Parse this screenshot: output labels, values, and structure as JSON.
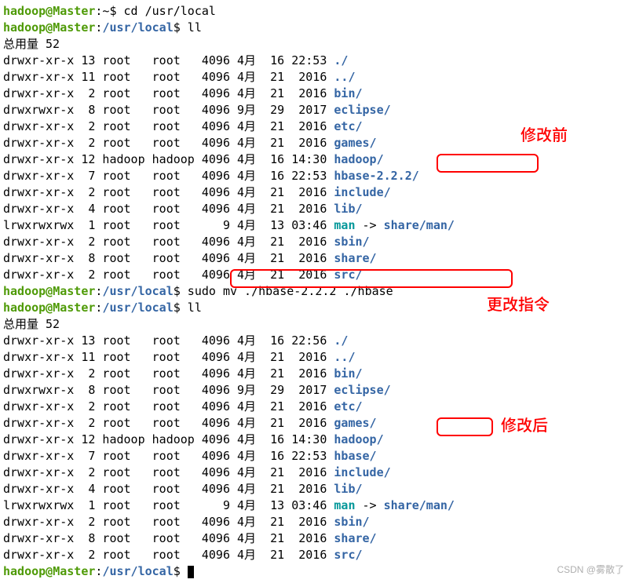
{
  "prompt1": {
    "user": "hadoop",
    "host": "Master",
    "path": "~",
    "cmd": "cd /usr/local"
  },
  "prompt2": {
    "user": "hadoop",
    "host": "Master",
    "path": "/usr/local",
    "cmd": "ll"
  },
  "total1": "总用量 52",
  "ls1": [
    {
      "perm": "drwxr-xr-x",
      "links": "13",
      "owner": "root  ",
      "group": "root  ",
      "size": "4096",
      "month": "4月 ",
      "day": "16",
      "time": "22:53",
      "name": "./",
      "type": "dir"
    },
    {
      "perm": "drwxr-xr-x",
      "links": "11",
      "owner": "root  ",
      "group": "root  ",
      "size": "4096",
      "month": "4月 ",
      "day": "21",
      "time": " 2016",
      "name": "../",
      "type": "dir"
    },
    {
      "perm": "drwxr-xr-x",
      "links": " 2",
      "owner": "root  ",
      "group": "root  ",
      "size": "4096",
      "month": "4月 ",
      "day": "21",
      "time": " 2016",
      "name": "bin/",
      "type": "dir"
    },
    {
      "perm": "drwxrwxr-x",
      "links": " 8",
      "owner": "root  ",
      "group": "root  ",
      "size": "4096",
      "month": "9月 ",
      "day": "29",
      "time": " 2017",
      "name": "eclipse/",
      "type": "dir"
    },
    {
      "perm": "drwxr-xr-x",
      "links": " 2",
      "owner": "root  ",
      "group": "root  ",
      "size": "4096",
      "month": "4月 ",
      "day": "21",
      "time": " 2016",
      "name": "etc/",
      "type": "dir"
    },
    {
      "perm": "drwxr-xr-x",
      "links": " 2",
      "owner": "root  ",
      "group": "root  ",
      "size": "4096",
      "month": "4月 ",
      "day": "21",
      "time": " 2016",
      "name": "games/",
      "type": "dir"
    },
    {
      "perm": "drwxr-xr-x",
      "links": "12",
      "owner": "hadoop",
      "group": "hadoop",
      "size": "4096",
      "month": "4月 ",
      "day": "16",
      "time": "14:30",
      "name": "hadoop/",
      "type": "dir"
    },
    {
      "perm": "drwxr-xr-x",
      "links": " 7",
      "owner": "root  ",
      "group": "root  ",
      "size": "4096",
      "month": "4月 ",
      "day": "16",
      "time": "22:53",
      "name": "hbase-2.2.2/",
      "type": "dir"
    },
    {
      "perm": "drwxr-xr-x",
      "links": " 2",
      "owner": "root  ",
      "group": "root  ",
      "size": "4096",
      "month": "4月 ",
      "day": "21",
      "time": " 2016",
      "name": "include/",
      "type": "dir"
    },
    {
      "perm": "drwxr-xr-x",
      "links": " 4",
      "owner": "root  ",
      "group": "root  ",
      "size": "4096",
      "month": "4月 ",
      "day": "21",
      "time": " 2016",
      "name": "lib/",
      "type": "dir"
    },
    {
      "perm": "lrwxrwxrwx",
      "links": " 1",
      "owner": "root  ",
      "group": "root  ",
      "size": "   9",
      "month": "4月 ",
      "day": "13",
      "time": "03:46",
      "name": "man",
      "type": "sym",
      "target": "share/man/"
    },
    {
      "perm": "drwxr-xr-x",
      "links": " 2",
      "owner": "root  ",
      "group": "root  ",
      "size": "4096",
      "month": "4月 ",
      "day": "21",
      "time": " 2016",
      "name": "sbin/",
      "type": "dir"
    },
    {
      "perm": "drwxr-xr-x",
      "links": " 8",
      "owner": "root  ",
      "group": "root  ",
      "size": "4096",
      "month": "4月 ",
      "day": "21",
      "time": " 2016",
      "name": "share/",
      "type": "dir"
    },
    {
      "perm": "drwxr-xr-x",
      "links": " 2",
      "owner": "root  ",
      "group": "root  ",
      "size": "4096",
      "month": "4月 ",
      "day": "21",
      "time": " 2016",
      "name": "src/",
      "type": "dir"
    }
  ],
  "prompt3": {
    "user": "hadoop",
    "host": "Master",
    "path": "/usr/local",
    "cmd": "sudo mv ./hbase-2.2.2 ./hbase"
  },
  "prompt4": {
    "user": "hadoop",
    "host": "Master",
    "path": "/usr/local",
    "cmd": "ll"
  },
  "total2": "总用量 52",
  "ls2": [
    {
      "perm": "drwxr-xr-x",
      "links": "13",
      "owner": "root  ",
      "group": "root  ",
      "size": "4096",
      "month": "4月 ",
      "day": "16",
      "time": "22:56",
      "name": "./",
      "type": "dir"
    },
    {
      "perm": "drwxr-xr-x",
      "links": "11",
      "owner": "root  ",
      "group": "root  ",
      "size": "4096",
      "month": "4月 ",
      "day": "21",
      "time": " 2016",
      "name": "../",
      "type": "dir"
    },
    {
      "perm": "drwxr-xr-x",
      "links": " 2",
      "owner": "root  ",
      "group": "root  ",
      "size": "4096",
      "month": "4月 ",
      "day": "21",
      "time": " 2016",
      "name": "bin/",
      "type": "dir"
    },
    {
      "perm": "drwxrwxr-x",
      "links": " 8",
      "owner": "root  ",
      "group": "root  ",
      "size": "4096",
      "month": "9月 ",
      "day": "29",
      "time": " 2017",
      "name": "eclipse/",
      "type": "dir"
    },
    {
      "perm": "drwxr-xr-x",
      "links": " 2",
      "owner": "root  ",
      "group": "root  ",
      "size": "4096",
      "month": "4月 ",
      "day": "21",
      "time": " 2016",
      "name": "etc/",
      "type": "dir"
    },
    {
      "perm": "drwxr-xr-x",
      "links": " 2",
      "owner": "root  ",
      "group": "root  ",
      "size": "4096",
      "month": "4月 ",
      "day": "21",
      "time": " 2016",
      "name": "games/",
      "type": "dir"
    },
    {
      "perm": "drwxr-xr-x",
      "links": "12",
      "owner": "hadoop",
      "group": "hadoop",
      "size": "4096",
      "month": "4月 ",
      "day": "16",
      "time": "14:30",
      "name": "hadoop/",
      "type": "dir"
    },
    {
      "perm": "drwxr-xr-x",
      "links": " 7",
      "owner": "root  ",
      "group": "root  ",
      "size": "4096",
      "month": "4月 ",
      "day": "16",
      "time": "22:53",
      "name": "hbase/",
      "type": "dir"
    },
    {
      "perm": "drwxr-xr-x",
      "links": " 2",
      "owner": "root  ",
      "group": "root  ",
      "size": "4096",
      "month": "4月 ",
      "day": "21",
      "time": " 2016",
      "name": "include/",
      "type": "dir"
    },
    {
      "perm": "drwxr-xr-x",
      "links": " 4",
      "owner": "root  ",
      "group": "root  ",
      "size": "4096",
      "month": "4月 ",
      "day": "21",
      "time": " 2016",
      "name": "lib/",
      "type": "dir"
    },
    {
      "perm": "lrwxrwxrwx",
      "links": " 1",
      "owner": "root  ",
      "group": "root  ",
      "size": "   9",
      "month": "4月 ",
      "day": "13",
      "time": "03:46",
      "name": "man",
      "type": "sym",
      "target": "share/man/"
    },
    {
      "perm": "drwxr-xr-x",
      "links": " 2",
      "owner": "root  ",
      "group": "root  ",
      "size": "4096",
      "month": "4月 ",
      "day": "21",
      "time": " 2016",
      "name": "sbin/",
      "type": "dir"
    },
    {
      "perm": "drwxr-xr-x",
      "links": " 8",
      "owner": "root  ",
      "group": "root  ",
      "size": "4096",
      "month": "4月 ",
      "day": "21",
      "time": " 2016",
      "name": "share/",
      "type": "dir"
    },
    {
      "perm": "drwxr-xr-x",
      "links": " 2",
      "owner": "root  ",
      "group": "root  ",
      "size": "4096",
      "month": "4月 ",
      "day": "21",
      "time": " 2016",
      "name": "src/",
      "type": "dir"
    }
  ],
  "prompt5": {
    "user": "hadoop",
    "host": "Master",
    "path": "/usr/local",
    "cmd": ""
  },
  "annotations": {
    "before": "修改前",
    "change": "更改指令",
    "after": "修改后"
  },
  "watermark": "CSDN @雾散了"
}
